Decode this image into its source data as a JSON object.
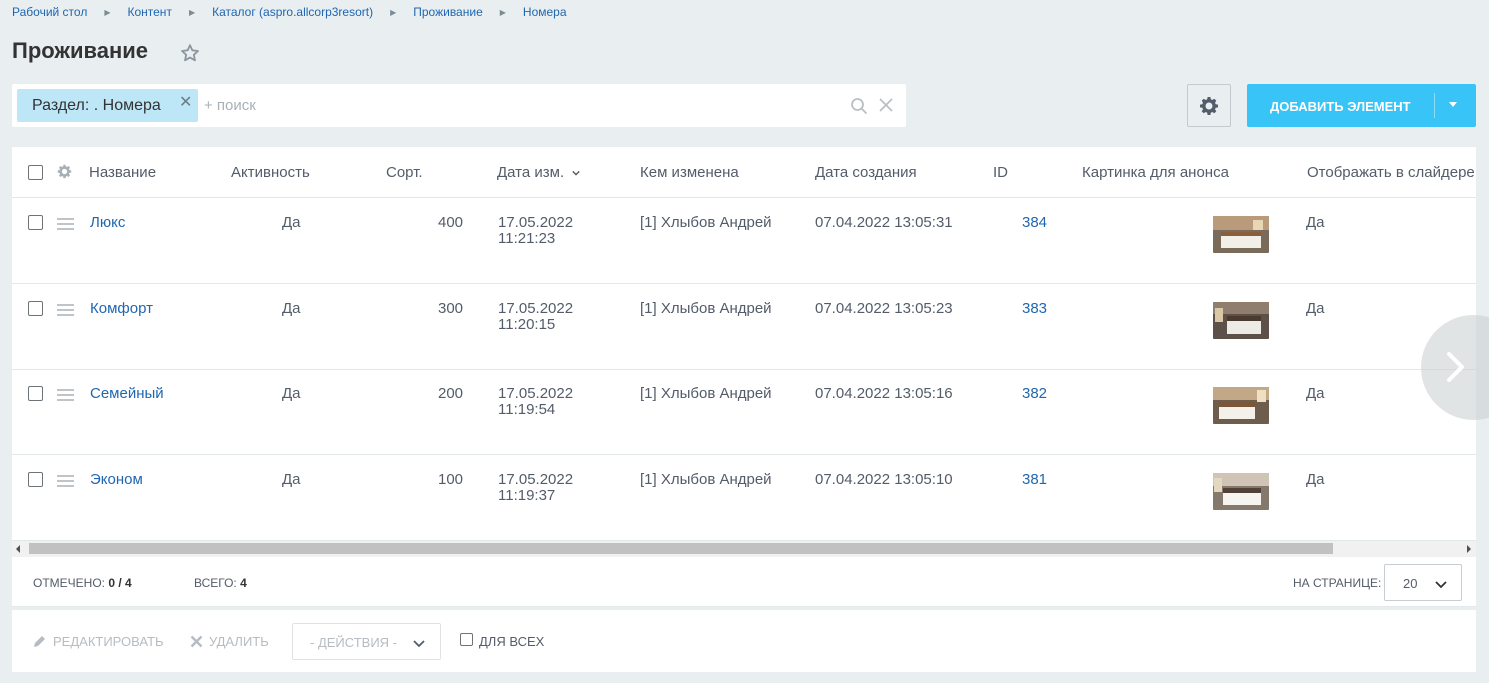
{
  "breadcrumb": [
    "Рабочий стол",
    "Контент",
    "Каталог (aspro.allcorp3resort)",
    "Проживание",
    "Номера"
  ],
  "page_title": "Проживание",
  "filter": {
    "chip_label": "Раздел: . Номера",
    "search_placeholder": "+ поиск"
  },
  "toolbar": {
    "add_button_label": "ДОБАВИТЬ ЭЛЕМЕНТ"
  },
  "table": {
    "headers": {
      "name": "Название",
      "active": "Активность",
      "sort": "Сорт.",
      "modified": "Дата изм.",
      "modified_by": "Кем изменена",
      "created": "Дата создания",
      "id": "ID",
      "preview_image": "Картинка для анонса",
      "show_in_slider": "Отображать в слайдере"
    },
    "rows": [
      {
        "name": "Люкс",
        "active": "Да",
        "sort": "400",
        "modified_date": "17.05.2022",
        "modified_time": "11:21:23",
        "modified_by": "[1] Хлыбов Андрей",
        "created": "07.04.2022 13:05:31",
        "id": "384",
        "slider": "Да"
      },
      {
        "name": "Комфорт",
        "active": "Да",
        "sort": "300",
        "modified_date": "17.05.2022",
        "modified_time": "11:20:15",
        "modified_by": "[1] Хлыбов Андрей",
        "created": "07.04.2022 13:05:23",
        "id": "383",
        "slider": "Да"
      },
      {
        "name": "Семейный",
        "active": "Да",
        "sort": "200",
        "modified_date": "17.05.2022",
        "modified_time": "11:19:54",
        "modified_by": "[1] Хлыбов Андрей",
        "created": "07.04.2022 13:05:16",
        "id": "382",
        "slider": "Да"
      },
      {
        "name": "Эконом",
        "active": "Да",
        "sort": "100",
        "modified_date": "17.05.2022",
        "modified_time": "11:19:37",
        "modified_by": "[1] Хлыбов Андрей",
        "created": "07.04.2022 13:05:10",
        "id": "381",
        "slider": "Да"
      }
    ]
  },
  "footer": {
    "checked_label": "ОТМЕЧЕНО:",
    "checked_value": "0 / 4",
    "total_label": "ВСЕГО:",
    "total_value": "4",
    "per_page_label": "НА СТРАНИЦЕ:",
    "per_page_value": "20"
  },
  "actions": {
    "edit": "РЕДАКТИРОВАТЬ",
    "delete": "УДАЛИТЬ",
    "actions_select": "- ДЕЙСТВИЯ -",
    "for_all": "ДЛЯ ВСЕХ"
  },
  "colors": {
    "accent": "#38c4f6",
    "link": "#2067b0",
    "chip": "#bde6f7",
    "background": "#e9eef1"
  }
}
